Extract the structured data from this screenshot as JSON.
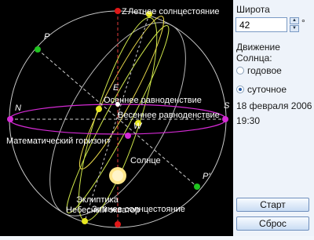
{
  "sky": {
    "labels": {
      "z": "Z",
      "summer": "Летнее солнцестояние",
      "p": "P",
      "e": "E",
      "autumn": "Осеннее равноденствие",
      "n": "N",
      "s": "S",
      "vernal": "Весеннее равноденствие",
      "w": "W",
      "horizon": "Математический горизонт",
      "sun": "Солнце",
      "p_prime": "P'",
      "ecliptic": "Эклиптика",
      "equator": "Небесный экватор",
      "winter": "Зимнее солнцестояние"
    }
  },
  "panel": {
    "latitude_label": "Широта",
    "latitude_value": "42",
    "degree_symbol": "°",
    "motion_title_line1": "Движение",
    "motion_title_line2": "Солнца:",
    "annual_label": "годовое",
    "daily_label": "суточное",
    "selected_motion": "daily",
    "date": "18 февраля 2006",
    "time": "19:30",
    "start_button": "Старт",
    "reset_button": "Сброс"
  }
}
